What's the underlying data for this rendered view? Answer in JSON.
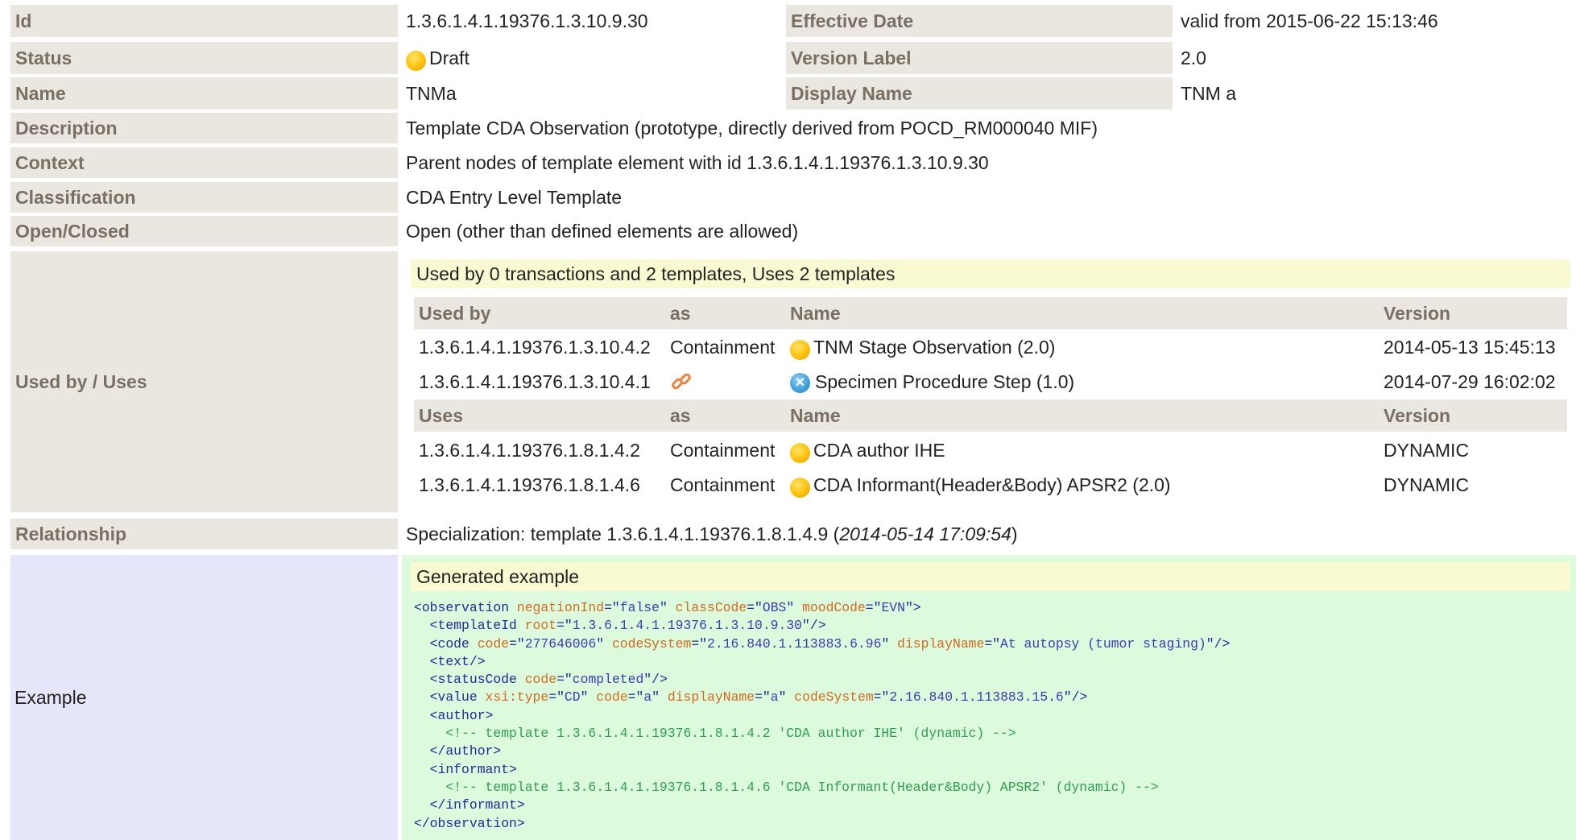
{
  "rows": {
    "id": {
      "label": "Id",
      "value": "1.3.6.1.4.1.19376.1.3.10.9.30"
    },
    "effective_date": {
      "label": "Effective Date",
      "value": "valid from 2015-06-22 15:13:46"
    },
    "status": {
      "label": "Status",
      "value": "Draft",
      "icon": "draft-status-icon"
    },
    "version_label": {
      "label": "Version Label",
      "value": "2.0"
    },
    "name": {
      "label": "Name",
      "value": "TNMa"
    },
    "display_name": {
      "label": "Display Name",
      "value": "TNM a"
    },
    "description": {
      "label": "Description",
      "value": "Template CDA Observation (prototype, directly derived from POCD_RM000040 MIF)"
    },
    "context": {
      "label": "Context",
      "value": "Parent nodes of template element with id 1.3.6.1.4.1.19376.1.3.10.9.30"
    },
    "classification": {
      "label": "Classification",
      "value": "CDA Entry Level Template"
    },
    "open_closed": {
      "label": "Open/Closed",
      "value": "Open (other than defined elements are allowed)"
    },
    "used_by_uses": {
      "label": "Used by / Uses"
    },
    "relationship": {
      "label": "Relationship",
      "prefix": "Specialization: template 1.3.6.1.4.1.19376.1.8.1.4.9 (",
      "date": "2014-05-14 17:09:54",
      "suffix": ")"
    },
    "example": {
      "label": "Example"
    }
  },
  "used_by": {
    "summary": "Used by 0 transactions and 2 templates, Uses 2 templates",
    "used_by_headers": {
      "id": "Used by",
      "as": "as",
      "name": "Name",
      "version": "Version"
    },
    "used_by_rows": [
      {
        "id": "1.3.6.1.4.1.19376.1.3.10.4.2",
        "as": "Containment",
        "status_icon": "draft-status-icon",
        "name": "TNM Stage Observation (2.0)",
        "version": "2014-05-13 15:45:13"
      },
      {
        "id": "1.3.6.1.4.1.19376.1.3.10.4.1",
        "as": "",
        "as_icon": "link-icon",
        "status_icon": "cancelled-status-icon",
        "name": "Specimen Procedure Step (1.0)",
        "version": "2014-07-29 16:02:02"
      }
    ],
    "uses_headers": {
      "id": "Uses",
      "as": "as",
      "name": "Name",
      "version": "Version"
    },
    "uses_rows": [
      {
        "id": "1.3.6.1.4.1.19376.1.8.1.4.2",
        "as": "Containment",
        "status_icon": "draft-status-icon",
        "name": "CDA author IHE",
        "version": "DYNAMIC"
      },
      {
        "id": "1.3.6.1.4.1.19376.1.8.1.4.6",
        "as": "Containment",
        "status_icon": "draft-status-icon",
        "name": "CDA Informant(Header&Body) APSR2 (2.0)",
        "version": "DYNAMIC"
      }
    ]
  },
  "example": {
    "title": "Generated example",
    "lines": [
      "<observation negationInd=\"false\" classCode=\"OBS\" moodCode=\"EVN\">",
      "  <templateId root=\"1.3.6.1.4.1.19376.1.3.10.9.30\"/>",
      "  <code code=\"277646006\" codeSystem=\"2.16.840.1.113883.6.96\" displayName=\"At autopsy (tumor staging)\"/>",
      "  <text/>",
      "  <statusCode code=\"completed\"/>",
      "  <value xsi:type=\"CD\" code=\"a\" displayName=\"a\" codeSystem=\"2.16.840.1.113883.15.6\"/>",
      "  <author>",
      "    <!-- template 1.3.6.1.4.1.19376.1.8.1.4.2 'CDA author IHE' (dynamic) -->",
      "  </author>",
      "  <informant>",
      "    <!-- template 1.3.6.1.4.1.19376.1.8.1.4.6 'CDA Informant(Header&Body) APSR2' (dynamic) -->",
      "  </informant>",
      "</observation>"
    ]
  },
  "colors": {
    "label_bg": "#eae6e0",
    "label_text": "#7a6f63",
    "banner_bg": "#fafad2",
    "example_label_bg": "#e6e6fa",
    "example_bg": "#dcfadc",
    "code_tag": "#1c2c99",
    "code_attr_name": "#d2691e",
    "code_comment": "#2e9e4f"
  }
}
